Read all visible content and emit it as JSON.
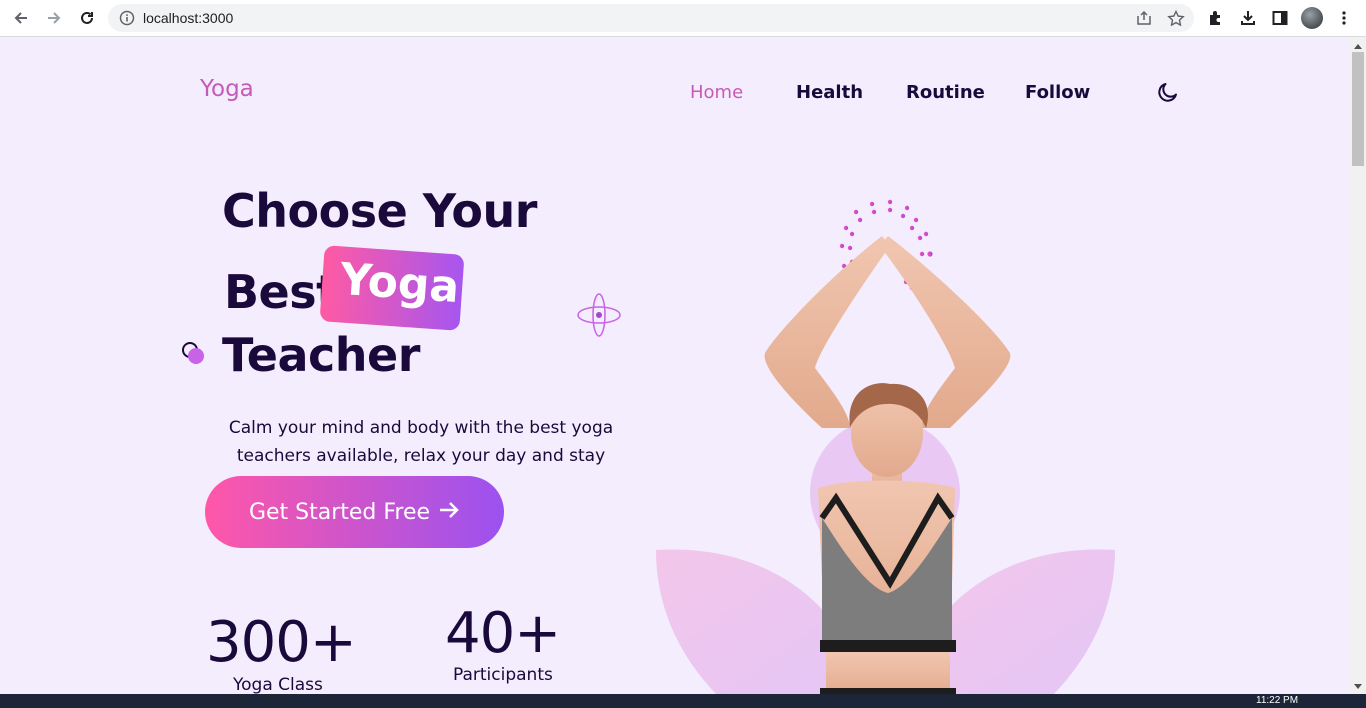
{
  "browser": {
    "url": "localhost:3000",
    "icons": [
      "back-icon",
      "forward-icon",
      "reload-icon",
      "info-icon",
      "share-icon",
      "star-icon",
      "extensions-icon",
      "download-icon",
      "sidepanel-icon",
      "profile-avatar",
      "more-icon"
    ]
  },
  "header": {
    "logo": "Yoga",
    "nav": [
      {
        "label": "Home",
        "active": true
      },
      {
        "label": "Health",
        "active": false
      },
      {
        "label": "Routine",
        "active": false
      },
      {
        "label": "Follow",
        "active": false
      }
    ],
    "theme_icon": "moon-icon"
  },
  "hero": {
    "line1": "Choose Your",
    "line2": "Best",
    "highlight": "Yoga",
    "line3": "Teacher",
    "description": "Calm your mind and body with the best yoga teachers available, relax your day and stay positive.",
    "cta_label": "Get Started Free",
    "cta_icon": "arrow-right-icon"
  },
  "stats": [
    {
      "value": "300+",
      "label": "Yoga Class"
    },
    {
      "value": "40+",
      "label": "Participants"
    }
  ],
  "taskbar": {
    "clock": "11:22 PM"
  },
  "colors": {
    "background": "#f3edfd",
    "heading": "#1a0a3c",
    "accent_pink": "#ff57a8",
    "accent_purple": "#9b52f0",
    "nav_active": "#c85ab5"
  }
}
